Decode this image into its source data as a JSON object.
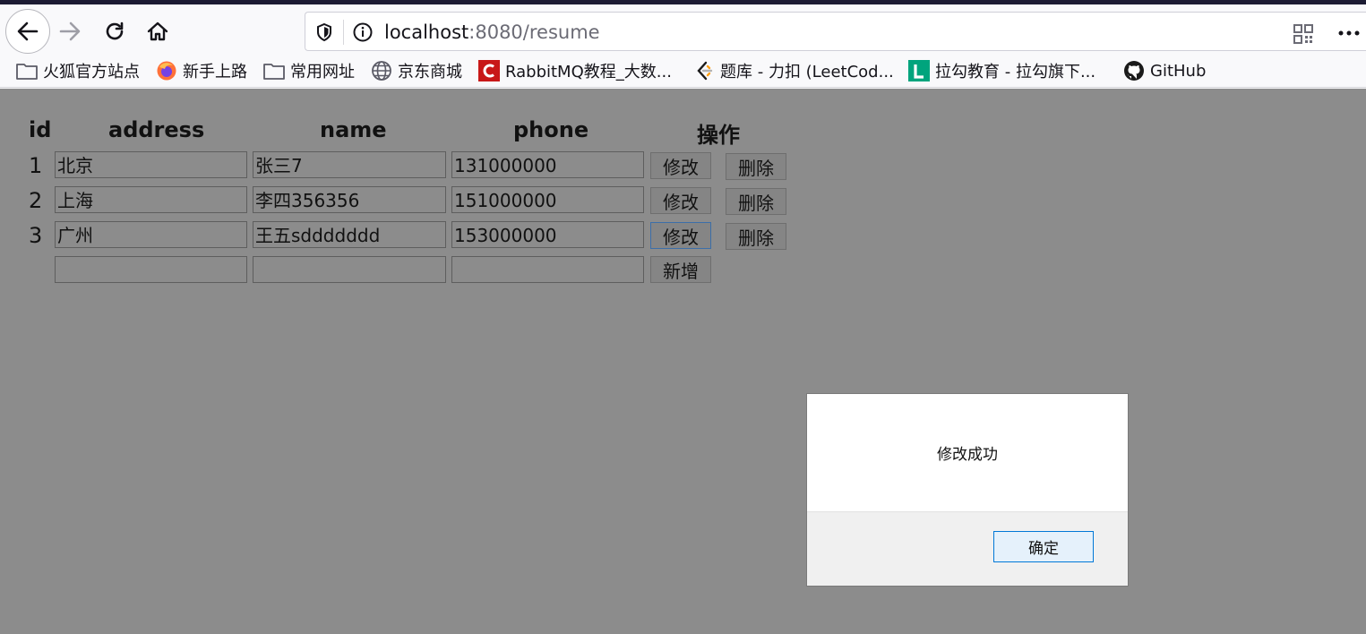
{
  "browser": {
    "url_host": "localhost",
    "url_rest": ":8080/resume",
    "icons": [
      "back-arrow-icon",
      "forward-arrow-icon",
      "reload-icon",
      "home-icon",
      "shield-icon",
      "info-icon",
      "qr-code-icon",
      "more-icon"
    ]
  },
  "bookmarks": [
    {
      "label": "火狐官方站点",
      "icon": "folder-icon"
    },
    {
      "label": "新手上路",
      "icon": "firefox-icon"
    },
    {
      "label": "常用网址",
      "icon": "folder-icon"
    },
    {
      "label": "京东商城",
      "icon": "globe-icon"
    },
    {
      "label": "RabbitMQ教程_大数...",
      "icon": "c-logo-icon"
    },
    {
      "label": "题库 - 力扣 (LeetCod...",
      "icon": "leetcode-icon"
    },
    {
      "label": "拉勾教育 - 拉勾旗下...",
      "icon": "lagou-icon"
    },
    {
      "label": "GitHub",
      "icon": "github-icon"
    }
  ],
  "table": {
    "headers": {
      "id": "id",
      "address": "address",
      "name": "name",
      "phone": "phone",
      "actions": "操作"
    },
    "rows": [
      {
        "id": "1",
        "address": "北京",
        "name": "张三7",
        "phone": "131000000",
        "edit": "修改",
        "delete": "删除"
      },
      {
        "id": "2",
        "address": "上海",
        "name": "李四356356",
        "phone": "151000000",
        "edit": "修改",
        "delete": "删除"
      },
      {
        "id": "3",
        "address": "广州",
        "name": "王五sddddddd",
        "phone": "153000000",
        "edit": "修改",
        "delete": "删除"
      }
    ],
    "new_row": {
      "address": "",
      "name": "",
      "phone": "",
      "add": "新增"
    }
  },
  "dialog": {
    "message": "修改成功",
    "ok_label": "确定"
  }
}
